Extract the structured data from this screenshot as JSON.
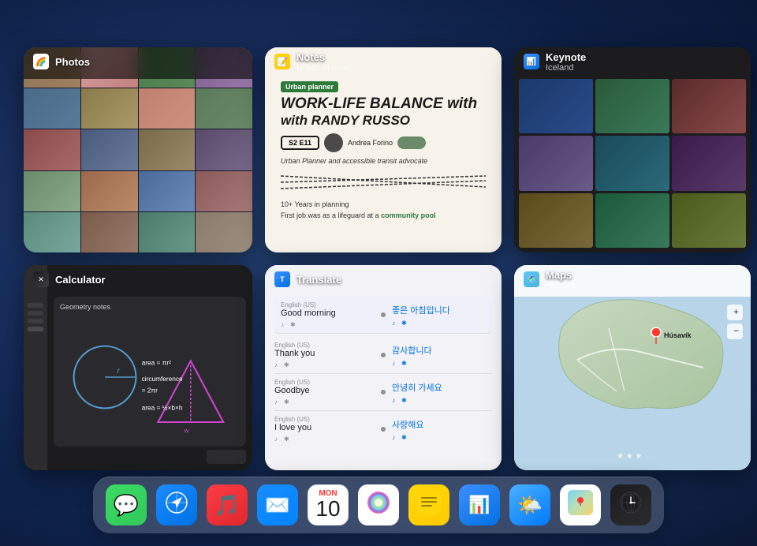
{
  "wallpaper": {
    "description": "Dark blue iPad wallpaper"
  },
  "apps": [
    {
      "id": "photos",
      "name": "Photos",
      "subtitle": "",
      "icon": "🖼️",
      "position": "top-left"
    },
    {
      "id": "notes",
      "name": "Notes",
      "subtitle": "Urban planner",
      "icon": "📝",
      "position": "top-center"
    },
    {
      "id": "keynote",
      "name": "Keynote",
      "subtitle": "Iceland",
      "icon": "📊",
      "position": "top-right"
    },
    {
      "id": "calculator",
      "name": "Calculator",
      "subtitle": "",
      "icon": "🔢",
      "position": "bottom-left"
    },
    {
      "id": "translate",
      "name": "Translate",
      "subtitle": "",
      "icon": "🌐",
      "position": "bottom-center"
    },
    {
      "id": "maps",
      "name": "Maps",
      "subtitle": "Húsavík",
      "icon": "🗺️",
      "position": "bottom-right"
    }
  ],
  "notes": {
    "title": "WORK-LIFE BALANCE",
    "title2": "with RANDY RUSSO",
    "badge": "S2 E11",
    "names": "Andrea Forino",
    "description": "Urban Planner and accessible transit advocate",
    "years": "10+ Years in planning",
    "last": "First job was as a lifeguard at a community pool"
  },
  "translate": {
    "rows": [
      {
        "lang_from": "English (US)",
        "text_from": "Good morning",
        "lang_to": "",
        "text_to": "좋은 아침입니다",
        "highlighted": true
      },
      {
        "lang_from": "English (US)",
        "text_from": "Thank you",
        "lang_to": "",
        "text_to": "감사합니다",
        "highlighted": false
      },
      {
        "lang_from": "English (US)",
        "text_from": "Goodbye",
        "lang_to": "",
        "text_to": "안녕히 가세요",
        "highlighted": false
      },
      {
        "lang_from": "English (US)",
        "text_from": "I love you",
        "lang_to": "",
        "text_to": "사랑해요",
        "highlighted": false
      }
    ]
  },
  "maps": {
    "location": "Húsavík"
  },
  "dock": {
    "apps": [
      {
        "id": "messages",
        "label": "Messages",
        "icon": "💬",
        "colorClass": "icon-messages"
      },
      {
        "id": "safari",
        "label": "Safari",
        "icon": "🧭",
        "colorClass": "icon-safari"
      },
      {
        "id": "music",
        "label": "Music",
        "icon": "🎵",
        "colorClass": "icon-music"
      },
      {
        "id": "mail",
        "label": "Mail",
        "icon": "✉️",
        "colorClass": "icon-mail"
      },
      {
        "id": "calendar",
        "label": "Calendar",
        "icon": "📅",
        "colorClass": "icon-calendar",
        "month": "MON",
        "day": "10"
      },
      {
        "id": "photos",
        "label": "Photos",
        "icon": "🌈",
        "colorClass": "icon-photos"
      },
      {
        "id": "notes",
        "label": "Notes",
        "icon": "📝",
        "colorClass": "icon-notes"
      },
      {
        "id": "keynote",
        "label": "Keynote",
        "icon": "📊",
        "colorClass": "icon-keynote"
      },
      {
        "id": "weather",
        "label": "Weather",
        "icon": "🌤️",
        "colorClass": "icon-weather"
      },
      {
        "id": "maps",
        "label": "Maps",
        "icon": "🗺️",
        "colorClass": "icon-maps"
      },
      {
        "id": "worldclock",
        "label": "World Clock",
        "icon": "🌍",
        "colorClass": "icon-worldclock"
      }
    ],
    "calendar_month": "MON",
    "calendar_day": "10"
  }
}
